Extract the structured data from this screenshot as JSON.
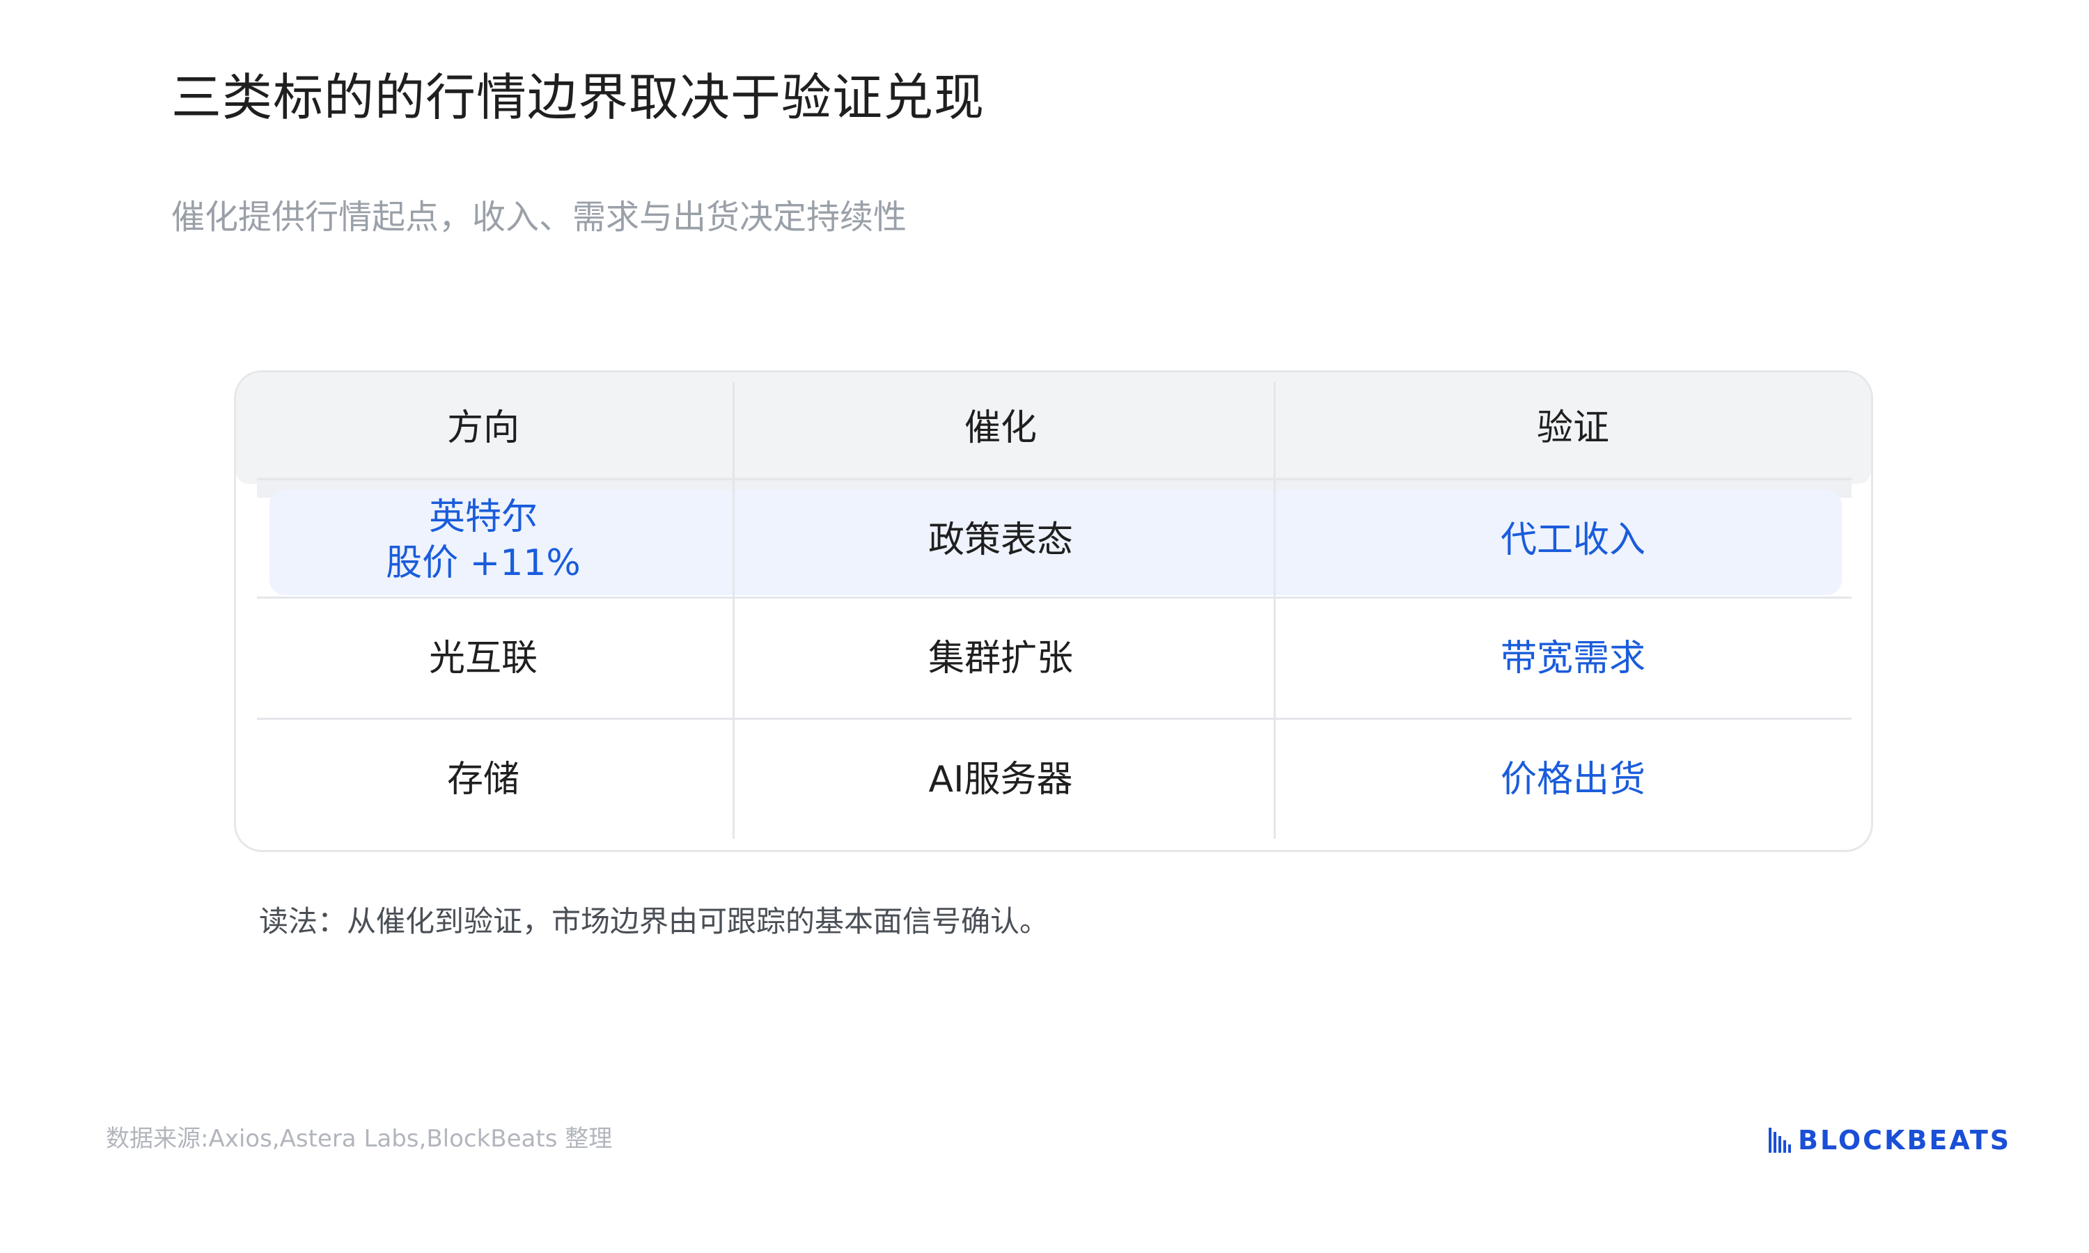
{
  "title": "三类标的的行情边界取决于验证兑现",
  "subtitle": "催化提供行情起点，收入、需求与出货决定持续性",
  "table": {
    "headers": [
      "方向",
      "催化",
      "验证"
    ],
    "rows": [
      {
        "direction_line1": "英特尔",
        "direction_line2": "股价 +11%",
        "catalyst": "政策表态",
        "validation": "代工收入",
        "highlighted": true
      },
      {
        "direction": "光互联",
        "catalyst": "集群扩张",
        "validation": "带宽需求",
        "highlighted": false
      },
      {
        "direction": "存储",
        "catalyst": "AI服务器",
        "validation": "价格出货",
        "highlighted": false
      }
    ]
  },
  "note": "读法：从催化到验证，市场边界由可跟踪的基本面信号确认。",
  "footer": {
    "source": "数据来源:Axios,Astera Labs,BlockBeats 整理",
    "logo_text": "BLOCKBEATS"
  },
  "colors": {
    "accent": "#1a5cdb",
    "header_bg": "#f2f3f5",
    "highlight_bg": "#eef3fd",
    "border": "#e4e6ea",
    "subtitle": "#9aa0a8"
  }
}
